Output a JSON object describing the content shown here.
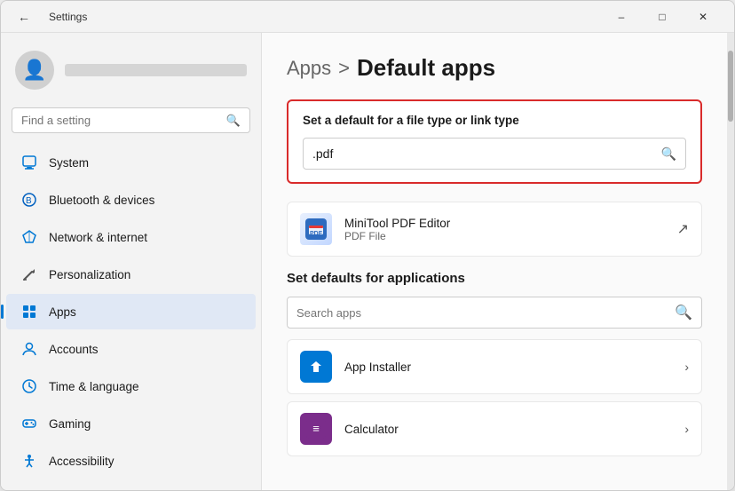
{
  "window": {
    "title": "Settings",
    "back_icon": "←",
    "minimize": "–",
    "maximize": "□",
    "close": "✕"
  },
  "sidebar": {
    "search_placeholder": "Find a setting",
    "search_icon": "🔍",
    "user_icon": "👤",
    "nav_items": [
      {
        "id": "system",
        "label": "System",
        "icon": "💻",
        "color": "#0078d4"
      },
      {
        "id": "bluetooth",
        "label": "Bluetooth & devices",
        "icon": "🔵",
        "color": "#0078d4"
      },
      {
        "id": "network",
        "label": "Network & internet",
        "icon": "🌐",
        "color": "#0078d4"
      },
      {
        "id": "personalization",
        "label": "Personalization",
        "icon": "✏️",
        "color": "#666"
      },
      {
        "id": "apps",
        "label": "Apps",
        "icon": "📦",
        "color": "#0078d4",
        "active": true
      },
      {
        "id": "accounts",
        "label": "Accounts",
        "icon": "👤",
        "color": "#0078d4"
      },
      {
        "id": "time",
        "label": "Time & language",
        "icon": "🌍",
        "color": "#0078d4"
      },
      {
        "id": "gaming",
        "label": "Gaming",
        "icon": "🎮",
        "color": "#0078d4"
      },
      {
        "id": "accessibility",
        "label": "Accessibility",
        "icon": "♿",
        "color": "#0078d4"
      }
    ]
  },
  "main": {
    "breadcrumb_parent": "Apps",
    "breadcrumb_sep": ">",
    "breadcrumb_current": "Default apps",
    "filetype_section": {
      "title": "Set a default for a file type or link type",
      "input_value": ".pdf",
      "search_icon": "🔍"
    },
    "associated_app": {
      "name": "MiniTool PDF Editor",
      "subtitle": "PDF File",
      "ext_icon": "↗"
    },
    "defaults_section": {
      "title": "Set defaults for applications",
      "search_placeholder": "Search apps",
      "search_icon": "🔍"
    },
    "app_list": [
      {
        "id": "app-installer",
        "name": "App Installer",
        "icon_color": "#0078d4"
      },
      {
        "id": "calculator",
        "name": "Calculator",
        "icon_color": "#7b2d8b"
      }
    ]
  }
}
